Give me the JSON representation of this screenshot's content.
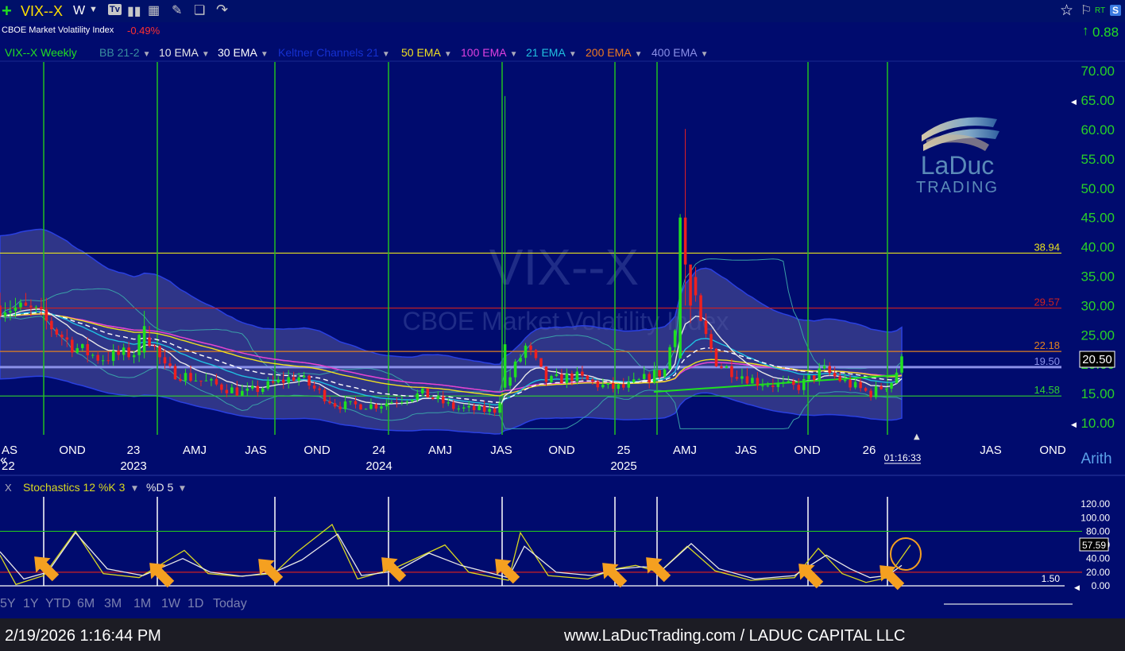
{
  "header": {
    "symbol": "VIX--X",
    "interval": "W",
    "name": "CBOE Market Volatility Index",
    "change_pct": "-0.49%",
    "change_value": "0.88",
    "rt_label": "RT",
    "s_badge": "S"
  },
  "studies": [
    {
      "label": "VIX--X Weekly",
      "color": "#22dd22"
    },
    {
      "label": "BB 21-2",
      "color": "#3a8fa0"
    },
    {
      "label": "10 EMA",
      "color": "#e8e8e8"
    },
    {
      "label": "30 EMA",
      "color": "#ffffff"
    },
    {
      "label": "Keltner Channels 21",
      "color": "#1530d0"
    },
    {
      "label": "50 EMA",
      "color": "#f0e020"
    },
    {
      "label": "100 EMA",
      "color": "#e040e0"
    },
    {
      "label": "21 EMA",
      "color": "#20c0e0"
    },
    {
      "label": "200 EMA",
      "color": "#ee7a20"
    },
    {
      "label": "400 EMA",
      "color": "#8a90e8"
    }
  ],
  "watermark": {
    "symbol": "VIX--X",
    "name": "CBOE Market Volatility Index"
  },
  "logo": {
    "line1": "LaDuc",
    "line2": "TRADING"
  },
  "price_axis": {
    "ticks": [
      "70.00",
      "65.00",
      "60.00",
      "55.00",
      "50.00",
      "45.00",
      "40.00",
      "35.00",
      "30.00",
      "25.00",
      "20.00",
      "15.00",
      "10.00"
    ],
    "current_price": "20.50"
  },
  "levels": [
    {
      "value": 38.94,
      "label": "38.94",
      "color": "#e8e020"
    },
    {
      "value": 29.57,
      "label": "29.57",
      "color": "#d02020"
    },
    {
      "value": 22.18,
      "label": "22.18",
      "color": "#e08020"
    },
    {
      "value": 19.5,
      "label": "19.50",
      "color": "#8a90e8"
    },
    {
      "value": 14.58,
      "label": "14.58",
      "color": "#30d030"
    }
  ],
  "time_axis": {
    "labels": [
      "OND",
      "23",
      "AMJ",
      "JAS",
      "OND",
      "24",
      "AMJ",
      "JAS",
      "OND",
      "25",
      "AMJ",
      "JAS",
      "OND",
      "26",
      "JAS",
      "OND"
    ],
    "years": [
      "2023",
      "2024",
      "2025"
    ],
    "left_edge_1": "AS",
    "left_edge_2": "22",
    "countdown": "01:16:33",
    "scale_mode": "Arith"
  },
  "stochastic": {
    "label": "Stochastics 12 %K 3",
    "d_label": "%D 5",
    "close_marker": "X",
    "ticks": [
      "120.00",
      "100.00",
      "80.00",
      "60.00",
      "40.00",
      "20.00",
      "0.00"
    ],
    "current_value": "57.59",
    "low_label": "1.50"
  },
  "range_buttons": [
    "5Y",
    "1Y",
    "YTD",
    "6M",
    "3M",
    "1M",
    "1W",
    "1D",
    "Today"
  ],
  "footer": {
    "datetime": "2/19/2026 1:16:44 PM",
    "site": "www.LaDucTrading.com / LADUC CAPITAL LLC"
  },
  "chart_data": [
    {
      "type": "candlestick",
      "title": "VIX--X Weekly",
      "ylim": [
        10,
        70
      ],
      "x_range": [
        "2022-09",
        "2026-12"
      ],
      "log_scale": false,
      "key_points": [
        {
          "x": "2022-10",
          "close": 30
        },
        {
          "x": "2023-03",
          "high": 29
        },
        {
          "x": "2024-08",
          "high": 65.7
        },
        {
          "x": "2025-04",
          "high": 60.1
        },
        {
          "x": "2026-02",
          "close": 20.5
        }
      ],
      "horizontal_levels": [
        38.94,
        29.57,
        22.18,
        19.5,
        14.58
      ],
      "cycle_marker_dates": [
        "2022-11",
        "2023-05",
        "2023-10",
        "2024-03",
        "2024-08",
        "2025-01",
        "2025-03",
        "2025-10",
        "2026-02"
      ]
    },
    {
      "type": "line",
      "title": "Stochastics 12 %K 3 %D 5",
      "ylim": [
        0,
        120
      ],
      "reference_lines": [
        80,
        20
      ],
      "series": [
        {
          "name": "%K",
          "color": "#d8d820"
        },
        {
          "name": "%D",
          "color": "#e8e8e8"
        }
      ],
      "last_value": 57.59
    }
  ]
}
